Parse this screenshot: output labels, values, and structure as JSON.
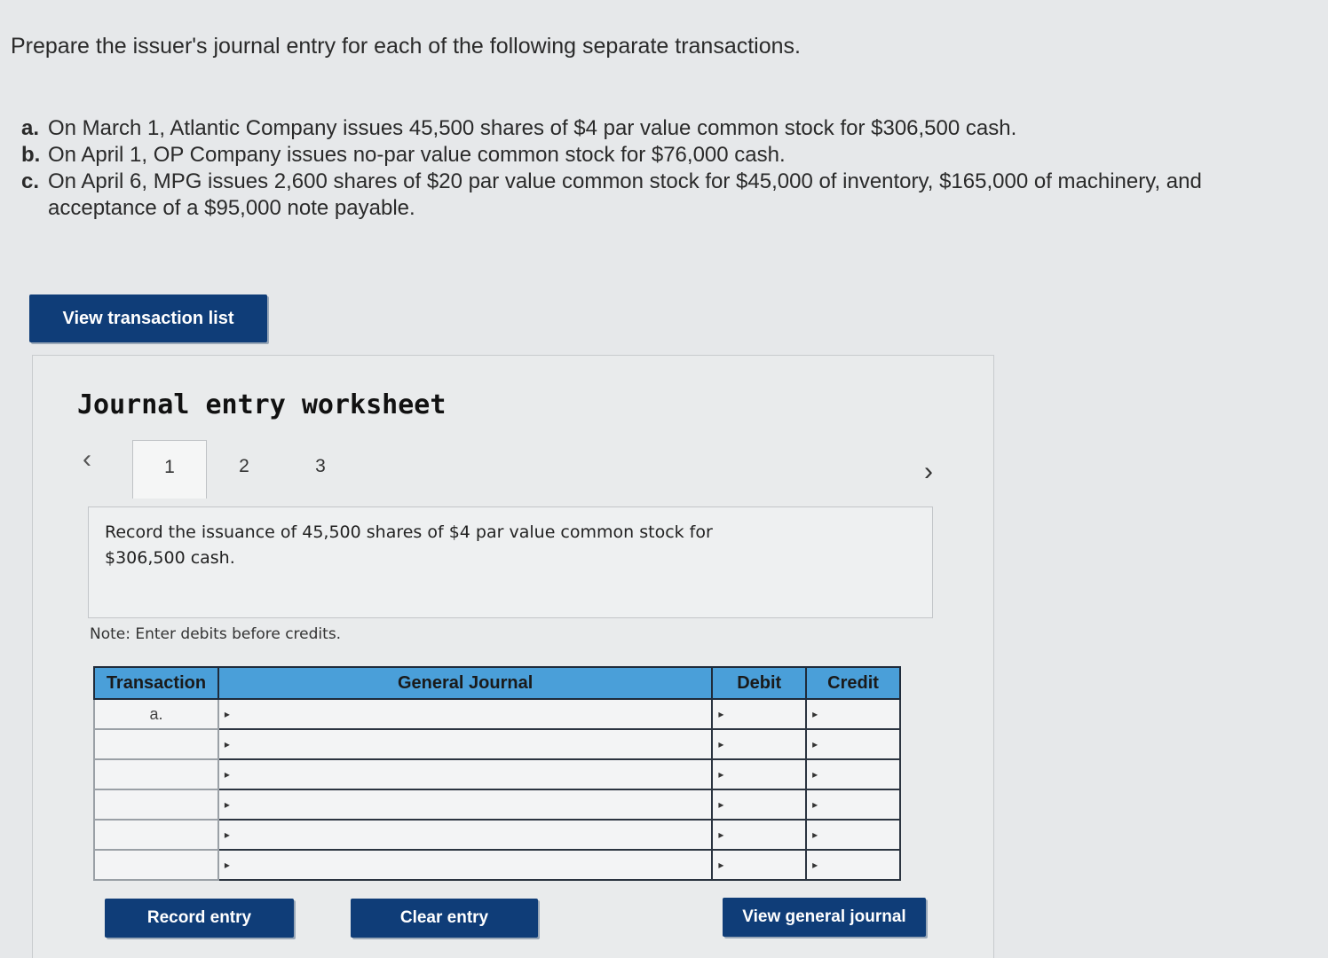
{
  "prompt": "Prepare the issuer's journal entry for each of the following separate transactions.",
  "transactions": [
    {
      "label": "a.",
      "text": "On March 1, Atlantic Company issues 45,500 shares of $4 par value common stock for $306,500 cash."
    },
    {
      "label": "b.",
      "text": "On April 1, OP Company issues no-par value common stock for $76,000 cash."
    },
    {
      "label": "c.",
      "text": "On April 6, MPG issues 2,600 shares of $20 par value common stock for $45,000 of inventory, $165,000 of machinery, and acceptance of a $95,000 note payable."
    }
  ],
  "view_transaction_list_label": "View transaction list",
  "worksheet": {
    "title": "Journal entry worksheet",
    "tabs": [
      "1",
      "2",
      "3"
    ],
    "active_tab": "1",
    "description": "Record the issuance of 45,500 shares of $4 par value common stock for $306,500 cash.",
    "note": "Note: Enter debits before credits.",
    "table": {
      "headers": [
        "Transaction",
        "General Journal",
        "Debit",
        "Credit"
      ],
      "rows": [
        {
          "transaction": "a.",
          "account": "",
          "debit": "",
          "credit": ""
        },
        {
          "transaction": "",
          "account": "",
          "debit": "",
          "credit": ""
        },
        {
          "transaction": "",
          "account": "",
          "debit": "",
          "credit": ""
        },
        {
          "transaction": "",
          "account": "",
          "debit": "",
          "credit": ""
        },
        {
          "transaction": "",
          "account": "",
          "debit": "",
          "credit": ""
        },
        {
          "transaction": "",
          "account": "",
          "debit": "",
          "credit": ""
        }
      ]
    },
    "buttons": {
      "record": "Record entry",
      "clear": "Clear entry",
      "view_general_journal": "View general journal"
    }
  },
  "colors": {
    "button_bg": "#0f3d78",
    "header_bg": "#4a9fd9"
  }
}
